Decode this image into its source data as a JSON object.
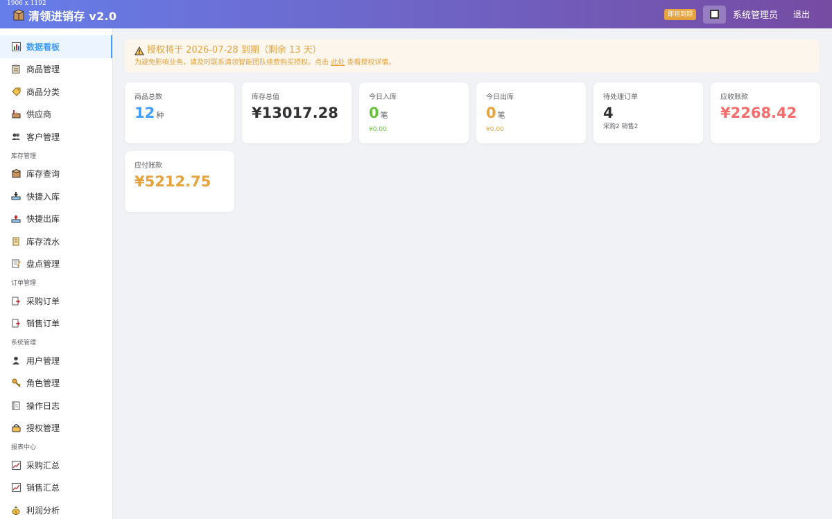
{
  "window": {
    "dims": "1906 x 1192"
  },
  "header": {
    "title": "清领进销存 v2.0",
    "expire_badge": "即将到期",
    "user_name": "系统管理员",
    "logout": "退出"
  },
  "colors": {
    "primary": "#409eff",
    "warning": "#e6a23c",
    "success": "#67c23a",
    "danger": "#f56c6c",
    "header_start": "#667eea",
    "header_end": "#764ba2"
  },
  "sidebar": {
    "items": [
      {
        "label": "数据看板",
        "icon": "chart-icon",
        "active": true
      },
      {
        "label": "商品管理",
        "icon": "clipboard-icon"
      },
      {
        "label": "商品分类",
        "icon": "tag-icon"
      },
      {
        "label": "供应商",
        "icon": "factory-icon"
      },
      {
        "label": "客户管理",
        "icon": "people-icon"
      }
    ],
    "group_inventory": "库存管理",
    "inventory_items": [
      {
        "label": "库存查询",
        "icon": "box-icon"
      },
      {
        "label": "快捷入库",
        "icon": "inbox-in-icon"
      },
      {
        "label": "快捷出库",
        "icon": "inbox-out-icon"
      },
      {
        "label": "库存流水",
        "icon": "scroll-icon"
      },
      {
        "label": "盘点管理",
        "icon": "memo-icon"
      }
    ],
    "group_orders": "订单管理",
    "order_items": [
      {
        "label": "采购订单",
        "icon": "doc-arrow-icon"
      },
      {
        "label": "销售订单",
        "icon": "doc-arrow-icon"
      }
    ],
    "group_system": "系统管理",
    "system_items": [
      {
        "label": "用户管理",
        "icon": "user-icon"
      },
      {
        "label": "角色管理",
        "icon": "key-icon"
      },
      {
        "label": "操作日志",
        "icon": "ledger-icon"
      },
      {
        "label": "授权管理",
        "icon": "lock-icon"
      }
    ],
    "group_reports": "报表中心",
    "report_items": [
      {
        "label": "采购汇总",
        "icon": "trend-icon"
      },
      {
        "label": "销售汇总",
        "icon": "trend-icon"
      },
      {
        "label": "利润分析",
        "icon": "money-bag-icon"
      }
    ]
  },
  "alert": {
    "title": "授权将于 2026-07-28 到期（剩余 13 天）",
    "desc_before": "为避免影响业务，请及时联系清领智能团队续费购买授权。点击 ",
    "link": "此处",
    "desc_after": " 查看授权详情。"
  },
  "cards": [
    {
      "label": "商品总数",
      "value": "12",
      "unit": "种",
      "sub": "",
      "color": "#409eff"
    },
    {
      "label": "库存总值",
      "value": "¥13017.28",
      "unit": "",
      "sub": "",
      "color": "#303133"
    },
    {
      "label": "今日入库",
      "value": "0",
      "unit": "笔",
      "sub": "¥0.00",
      "color": "#67c23a"
    },
    {
      "label": "今日出库",
      "value": "0",
      "unit": "笔",
      "sub": "¥0.00",
      "color": "#e6a23c"
    },
    {
      "label": "待处理订单",
      "value": "4",
      "unit": "",
      "sub": "采购2 销售2",
      "color": "#303133"
    },
    {
      "label": "应收账款",
      "value": "¥2268.42",
      "unit": "",
      "sub": "",
      "color": "#f56c6c"
    },
    {
      "label": "应付账款",
      "value": "¥5212.75",
      "unit": "",
      "sub": "",
      "color": "#e6a23c"
    }
  ]
}
